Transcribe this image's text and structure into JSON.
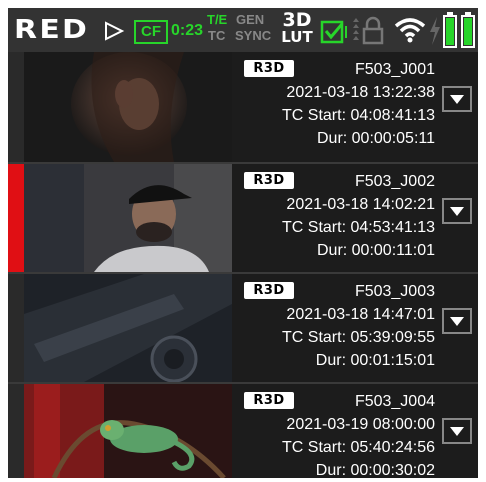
{
  "status_bar": {
    "brand": "RED",
    "media_label": "CF",
    "media_time": "0:23",
    "timecode_mode_top": "T/E",
    "timecode_mode_bottom": "TC",
    "genlock_top": "GEN",
    "genlock_bottom": "SYNC",
    "lut_top": "3D",
    "lut_bottom": "LUT",
    "accent_color": "#27d52a",
    "icons": [
      "red-play-arrow-icon",
      "checkbox-checked-icon",
      "lock-icon",
      "wifi-icon",
      "lightning-icon",
      "battery-icon"
    ]
  },
  "clips": [
    {
      "format": "R3D",
      "name": "F503_J001",
      "date": "2021-03-18 13:22:38",
      "tc_start": "TC Start: 04:08:41:13",
      "duration": "Dur: 00:00:05:11",
      "selected": false,
      "thumbnail": "woman-on-phone"
    },
    {
      "format": "R3D",
      "name": "F503_J002",
      "date": "2021-03-18 14:02:21",
      "tc_start": "TC Start: 04:53:41:13",
      "duration": "Dur: 00:00:11:01",
      "selected": true,
      "thumbnail": "man-in-cap"
    },
    {
      "format": "R3D",
      "name": "F503_J003",
      "date": "2021-03-18 14:47:01",
      "tc_start": "TC Start: 05:39:09:55",
      "duration": "Dur: 00:01:15:01",
      "selected": false,
      "thumbnail": "camera-gear"
    },
    {
      "format": "R3D",
      "name": "F503_J004",
      "date": "2021-03-19 08:00:00",
      "tc_start": "TC Start: 05:40:24:56",
      "duration": "Dur: 00:00:30:02",
      "selected": false,
      "thumbnail": "chameleon"
    }
  ]
}
